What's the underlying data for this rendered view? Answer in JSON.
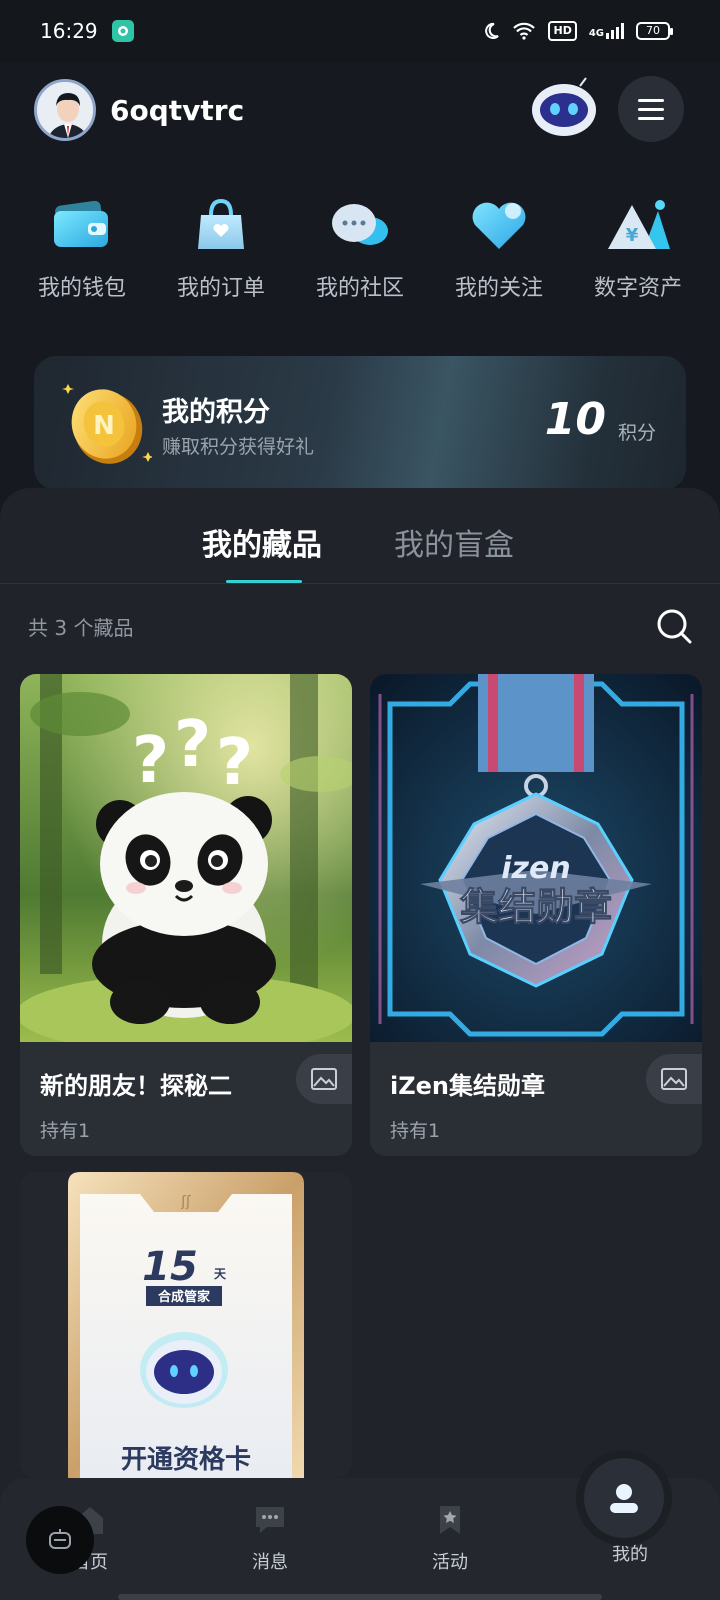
{
  "status_bar": {
    "time": "16:29",
    "hd": "HD",
    "signal": "4G",
    "battery": "70"
  },
  "header": {
    "username": "6oqtvtrc"
  },
  "quick_menu": [
    {
      "label": "我的钱包",
      "icon": "wallet-icon"
    },
    {
      "label": "我的订单",
      "icon": "bag-icon"
    },
    {
      "label": "我的社区",
      "icon": "chat-bubble-icon"
    },
    {
      "label": "我的关注",
      "icon": "heart-icon"
    },
    {
      "label": "数字资产",
      "icon": "yen-mountain-icon"
    }
  ],
  "points": {
    "title": "我的积分",
    "subtitle": "赚取积分获得好礼",
    "value": "10",
    "unit": "积分"
  },
  "tabs": [
    {
      "label": "我的藏品",
      "active": true
    },
    {
      "label": "我的盲盒",
      "active": false
    }
  ],
  "collection": {
    "count_text": "共 3 个藏品",
    "items": [
      {
        "title": "新的朋友！探秘二",
        "hold": "持有1"
      },
      {
        "title": "iZen集结勋章",
        "hold": "持有1",
        "medal_text_top": "izen",
        "medal_text_main": "集结勋章"
      },
      {
        "card_text_number": "15",
        "card_text_unit": "天",
        "card_text_badge": "合成管家",
        "card_text_bottom": "开通资格卡"
      }
    ]
  },
  "bottom_nav": [
    {
      "label": "首页"
    },
    {
      "label": "消息"
    },
    {
      "label": "活动"
    },
    {
      "label": "我的"
    }
  ],
  "colors": {
    "accent": "#35d0d6",
    "background": "#16191f",
    "sheet": "#202329"
  }
}
